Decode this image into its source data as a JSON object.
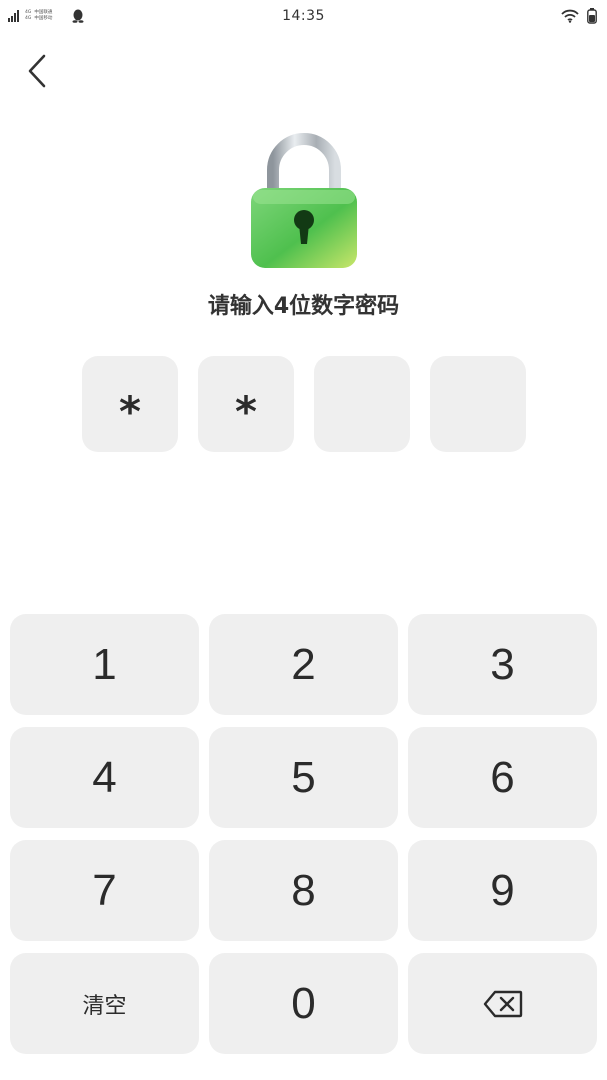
{
  "status_bar": {
    "time": "14:35",
    "carrier_1": "中国联通",
    "carrier_2": "中国移动",
    "network_1": "4G",
    "network_2": "4G"
  },
  "icons": {
    "back": "back-arrow-icon",
    "lock": "padlock-icon",
    "delete": "backspace-icon",
    "wifi": "wifi-icon",
    "battery": "battery-icon",
    "signal": "signal-icon",
    "qq": "qq-penguin-icon"
  },
  "prompt": "请输入4位数字密码",
  "pin": {
    "length": 4,
    "entered": 2,
    "mask_char": "*",
    "slots": [
      "*",
      "*",
      "",
      ""
    ]
  },
  "keypad": {
    "keys": [
      "1",
      "2",
      "3",
      "4",
      "5",
      "6",
      "7",
      "8",
      "9"
    ],
    "clear_label": "清空",
    "zero": "0"
  },
  "colors": {
    "lock_green": "#5cc95a",
    "key_bg": "#efefef",
    "text": "#2b2b2b"
  }
}
